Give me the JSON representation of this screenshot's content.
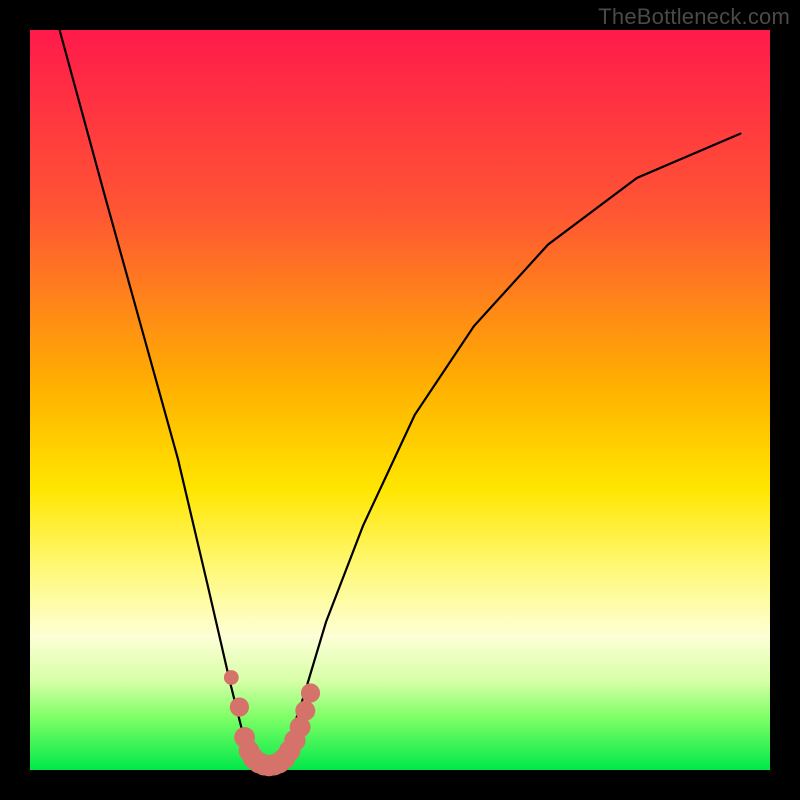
{
  "watermark": "TheBottleneck.com",
  "chart_data": {
    "type": "line",
    "title": "",
    "xlabel": "",
    "ylabel": "",
    "xlim": [
      0,
      100
    ],
    "ylim": [
      0,
      100
    ],
    "series": [
      {
        "name": "bottleneck-curve",
        "x": [
          4,
          10,
          15,
          20,
          24,
          27,
          29,
          30.5,
          32,
          33.5,
          35,
          37,
          40,
          45,
          52,
          60,
          70,
          82,
          96
        ],
        "values": [
          100,
          78,
          60,
          42,
          25,
          12,
          4,
          1,
          0,
          1,
          4,
          10,
          20,
          33,
          48,
          60,
          71,
          80,
          86
        ]
      }
    ],
    "markers": {
      "name": "highlight-dots",
      "color": "#d5736b",
      "points": [
        {
          "x": 27.2,
          "y": 12.5,
          "r": 1.0
        },
        {
          "x": 28.3,
          "y": 8.5,
          "r": 1.3
        },
        {
          "x": 29.0,
          "y": 4.4,
          "r": 1.4
        },
        {
          "x": 29.6,
          "y": 2.6,
          "r": 1.4
        },
        {
          "x": 30.2,
          "y": 1.6,
          "r": 1.45
        },
        {
          "x": 30.9,
          "y": 1.0,
          "r": 1.45
        },
        {
          "x": 31.6,
          "y": 0.7,
          "r": 1.45
        },
        {
          "x": 32.3,
          "y": 0.6,
          "r": 1.45
        },
        {
          "x": 33.0,
          "y": 0.7,
          "r": 1.45
        },
        {
          "x": 33.7,
          "y": 1.0,
          "r": 1.45
        },
        {
          "x": 34.4,
          "y": 1.6,
          "r": 1.45
        },
        {
          "x": 35.1,
          "y": 2.6,
          "r": 1.45
        },
        {
          "x": 35.8,
          "y": 4.0,
          "r": 1.45
        },
        {
          "x": 36.5,
          "y": 5.8,
          "r": 1.4
        },
        {
          "x": 37.2,
          "y": 8.0,
          "r": 1.35
        },
        {
          "x": 37.9,
          "y": 10.4,
          "r": 1.3
        }
      ]
    },
    "gradient_stops": [
      {
        "pos": 0.0,
        "color": "#ff1a4b"
      },
      {
        "pos": 0.25,
        "color": "#ff5733"
      },
      {
        "pos": 0.48,
        "color": "#ffb000"
      },
      {
        "pos": 0.62,
        "color": "#ffe600"
      },
      {
        "pos": 0.73,
        "color": "#fff97a"
      },
      {
        "pos": 0.82,
        "color": "#fdffd6"
      },
      {
        "pos": 0.88,
        "color": "#d6ffa6"
      },
      {
        "pos": 0.93,
        "color": "#7cff66"
      },
      {
        "pos": 1.0,
        "color": "#00e84a"
      }
    ]
  }
}
